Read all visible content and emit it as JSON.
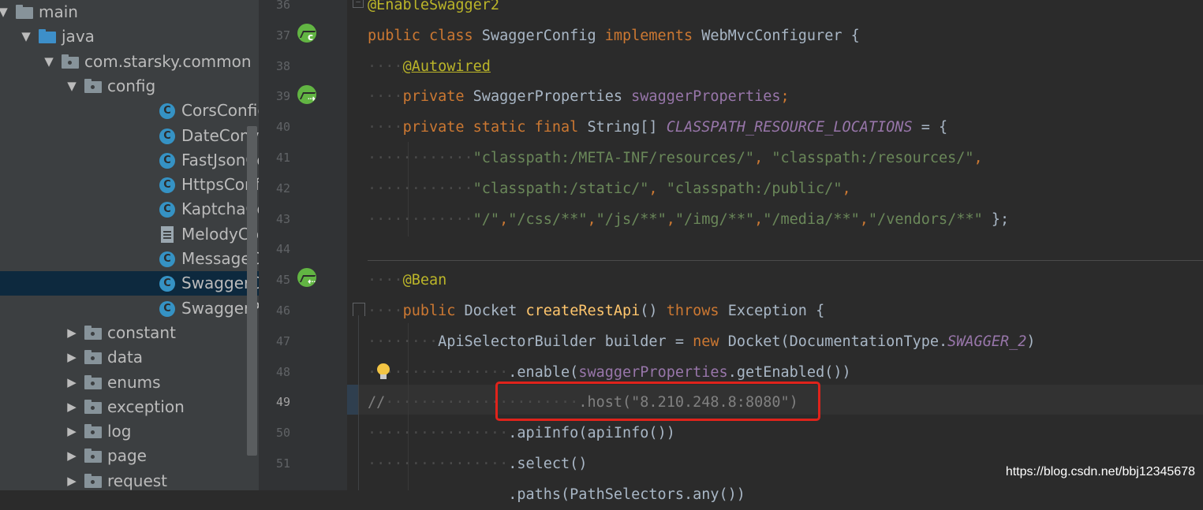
{
  "project_tree": {
    "items": [
      {
        "label": "main",
        "kind": "folder",
        "expanded": true
      },
      {
        "label": "java",
        "kind": "source-folder",
        "expanded": true
      },
      {
        "label": "com.starsky.common",
        "kind": "package",
        "expanded": true
      },
      {
        "label": "config",
        "kind": "package",
        "expanded": true
      },
      {
        "label": "CorsConfig",
        "kind": "class"
      },
      {
        "label": "DateConverter",
        "kind": "class"
      },
      {
        "label": "FastJsonConfig",
        "kind": "class"
      },
      {
        "label": "HttpsConfig",
        "kind": "class"
      },
      {
        "label": "KaptchaConfig",
        "kind": "class"
      },
      {
        "label": "MelodyConfig.java",
        "kind": "file"
      },
      {
        "label": "MessageConvertCon",
        "kind": "class"
      },
      {
        "label": "SwaggerConfig",
        "kind": "class",
        "selected": true
      },
      {
        "label": "SwaggerProperties",
        "kind": "class"
      },
      {
        "label": "constant",
        "kind": "package",
        "expanded": false
      },
      {
        "label": "data",
        "kind": "package",
        "expanded": false
      },
      {
        "label": "enums",
        "kind": "package",
        "expanded": false
      },
      {
        "label": "exception",
        "kind": "package",
        "expanded": false
      },
      {
        "label": "log",
        "kind": "package",
        "expanded": false
      },
      {
        "label": "page",
        "kind": "package",
        "expanded": false
      },
      {
        "label": "request",
        "kind": "package",
        "expanded": false
      }
    ]
  },
  "editor": {
    "line_numbers": [
      "36",
      "37",
      "38",
      "39",
      "40",
      "41",
      "42",
      "43",
      "44",
      "45",
      "46",
      "47",
      "48",
      "49",
      "50",
      "51"
    ],
    "current_line": "49",
    "lines": [
      [
        {
          "t": "@EnableSwagger2",
          "c": "ann"
        }
      ],
      [
        {
          "t": "public class ",
          "c": "kw"
        },
        {
          "t": "SwaggerConfig "
        },
        {
          "t": "implements ",
          "c": "kw"
        },
        {
          "t": "WebMvcConfigurer {"
        }
      ],
      [
        {
          "t": "····",
          "c": "ws"
        },
        {
          "t": "@Autowired",
          "c": "ann ul"
        }
      ],
      [
        {
          "t": "····",
          "c": "ws"
        },
        {
          "t": "private ",
          "c": "kw"
        },
        {
          "t": "SwaggerProperties "
        },
        {
          "t": "swaggerProperties",
          "c": "fld"
        },
        {
          "t": ";",
          "c": "kw"
        }
      ],
      [
        {
          "t": "····",
          "c": "ws"
        },
        {
          "t": "private static final ",
          "c": "kw"
        },
        {
          "t": "String[] "
        },
        {
          "t": "CLASSPATH_RESOURCE_LOCATIONS",
          "c": "cst"
        },
        {
          "t": " = {"
        }
      ],
      [
        {
          "t": "············",
          "c": "ws"
        },
        {
          "t": "\"classpath:/META-INF/resources/\"",
          "c": "str"
        },
        {
          "t": ", ",
          "c": "kw"
        },
        {
          "t": "\"classpath:/resources/\"",
          "c": "str"
        },
        {
          "t": ",",
          "c": "kw"
        }
      ],
      [
        {
          "t": "············",
          "c": "ws"
        },
        {
          "t": "\"classpath:/static/\"",
          "c": "str"
        },
        {
          "t": ", ",
          "c": "kw"
        },
        {
          "t": "\"classpath:/public/\"",
          "c": "str"
        },
        {
          "t": ",",
          "c": "kw"
        }
      ],
      [
        {
          "t": "············",
          "c": "ws"
        },
        {
          "t": "\"/\"",
          "c": "str"
        },
        {
          "t": ",",
          "c": "kw"
        },
        {
          "t": "\"/css/**\"",
          "c": "str"
        },
        {
          "t": ",",
          "c": "kw"
        },
        {
          "t": "\"/js/**\"",
          "c": "str"
        },
        {
          "t": ",",
          "c": "kw"
        },
        {
          "t": "\"/img/**\"",
          "c": "str"
        },
        {
          "t": ",",
          "c": "kw"
        },
        {
          "t": "\"/media/**\"",
          "c": "str"
        },
        {
          "t": ",",
          "c": "kw"
        },
        {
          "t": "\"/vendors/**\"",
          "c": "str"
        },
        {
          "t": " };"
        }
      ],
      [],
      [
        {
          "t": "····",
          "c": "ws"
        },
        {
          "t": "@Bean",
          "c": "ann"
        }
      ],
      [
        {
          "t": "····",
          "c": "ws"
        },
        {
          "t": "public ",
          "c": "kw"
        },
        {
          "t": "Docket "
        },
        {
          "t": "createRestApi",
          "c": "fn"
        },
        {
          "t": "() "
        },
        {
          "t": "throws ",
          "c": "kw"
        },
        {
          "t": "Exception {"
        }
      ],
      [
        {
          "t": "········",
          "c": "ws"
        },
        {
          "t": "ApiSelectorBuilder builder = "
        },
        {
          "t": "new ",
          "c": "kw"
        },
        {
          "t": "Docket(DocumentationType."
        },
        {
          "t": "SWAGGER_2",
          "c": "cst"
        },
        {
          "t": ")"
        }
      ],
      [
        {
          "t": "················",
          "c": "ws"
        },
        {
          "t": ".enable("
        },
        {
          "t": "swaggerProperties",
          "c": "fld"
        },
        {
          "t": ".getEnabled())"
        }
      ],
      [
        {
          "t": "//",
          "c": "cmt"
        },
        {
          "t": "······················",
          "c": "ws"
        },
        {
          "t": ".host(\"8.210.248.8:8080\")",
          "c": "cmt"
        }
      ],
      [
        {
          "t": "················",
          "c": "ws"
        },
        {
          "t": ".apiInfo(apiInfo())"
        }
      ],
      [
        {
          "t": "················",
          "c": "ws"
        },
        {
          "t": ".select()"
        }
      ]
    ],
    "partial_next_line": "                .paths(PathSelectors.any())"
  },
  "gutter_icons": [
    "spring-bean-icon",
    "spring-bean-icon",
    "spring-bean-icon"
  ],
  "highlighted_code": ".host(\"8.210.248.8:8080\")",
  "watermark": "https://blog.csdn.net/bbj12345678",
  "colors": {
    "keyword": "#cc7832",
    "annotation": "#bbb529",
    "string": "#6a8759",
    "field": "#9876aa",
    "method": "#ffc66d",
    "comment": "#808080",
    "highlight_box": "#e0231b",
    "selection": "#0d293e"
  }
}
